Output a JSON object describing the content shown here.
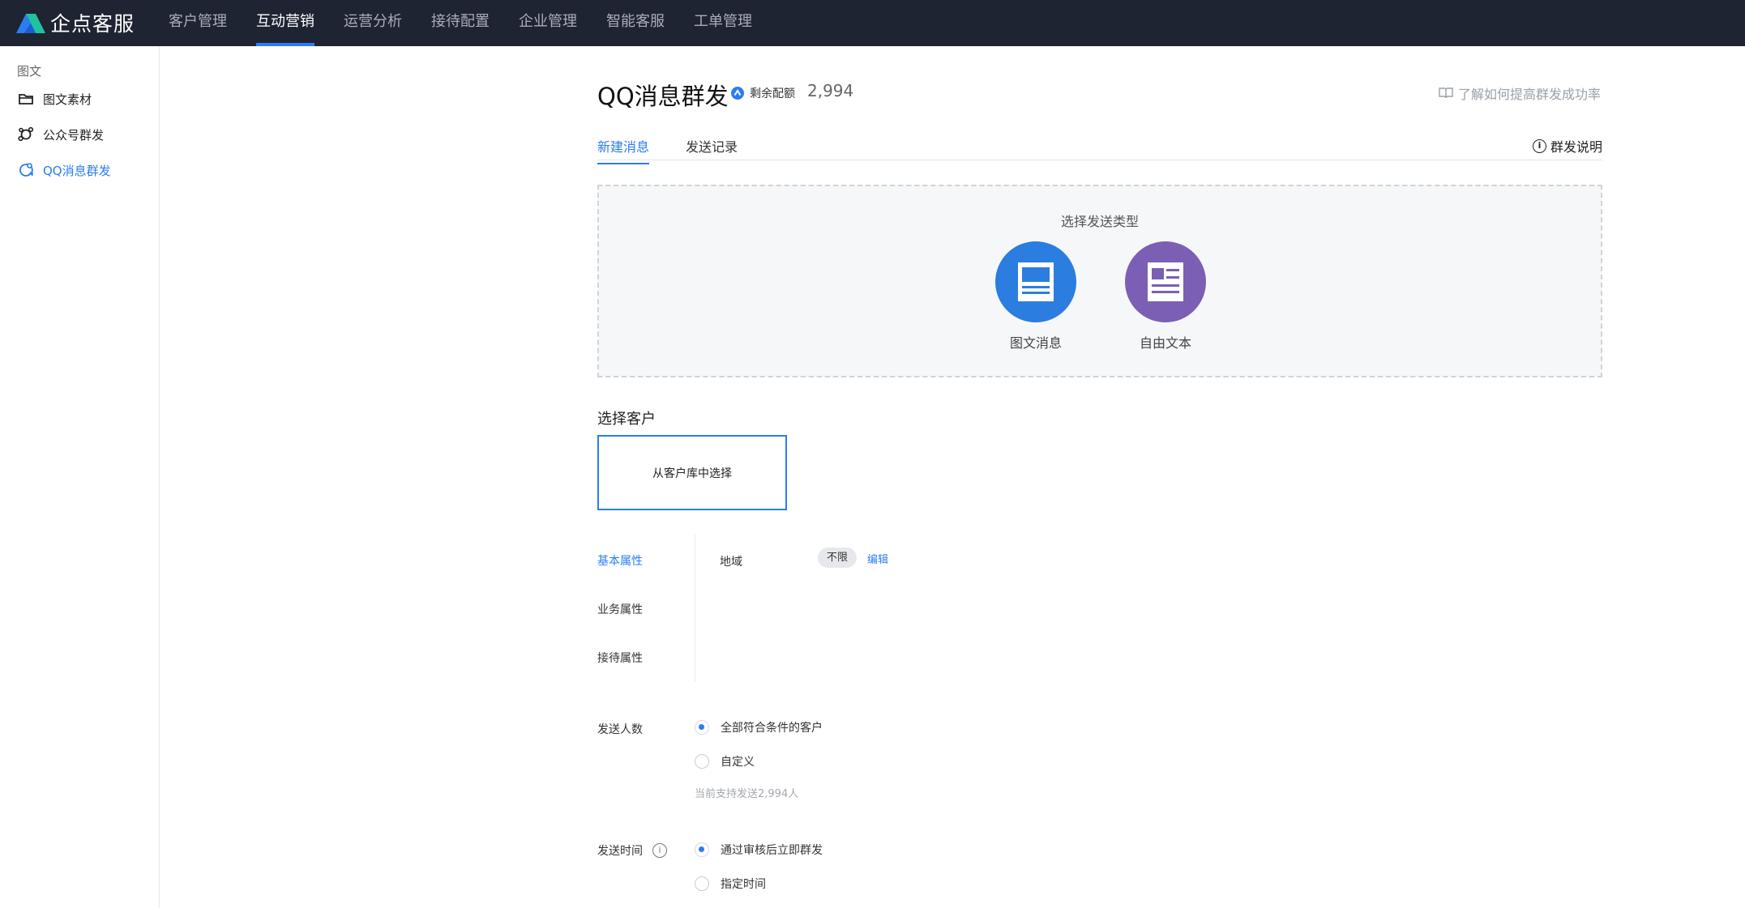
{
  "brand": {
    "name": "企点客服",
    "accent": "#2b7df0",
    "topbar_bg": "#1f2433"
  },
  "topnav": [
    {
      "label": "客户管理",
      "active": false
    },
    {
      "label": "互动营销",
      "active": true
    },
    {
      "label": "运营分析",
      "active": false
    },
    {
      "label": "接待配置",
      "active": false
    },
    {
      "label": "企业管理",
      "active": false
    },
    {
      "label": "智能客服",
      "active": false
    },
    {
      "label": "工单管理",
      "active": false
    }
  ],
  "sidebar": {
    "group_label": "图文",
    "items": [
      {
        "label": "图文素材",
        "icon": "folder-icon",
        "active": false
      },
      {
        "label": "公众号群发",
        "icon": "broadcast-icon",
        "active": false
      },
      {
        "label": "QQ消息群发",
        "icon": "qq-chat-icon",
        "active": true
      }
    ]
  },
  "header": {
    "title": "QQ消息群发",
    "quota_label": "剩余配额",
    "quota_value": "2,994",
    "help_link": "了解如何提高群发成功率"
  },
  "tabs": {
    "items": [
      {
        "label": "新建消息",
        "active": true
      },
      {
        "label": "发送记录",
        "active": false
      }
    ],
    "help": "群发说明"
  },
  "send_type": {
    "title": "选择发送类型",
    "options": [
      {
        "label": "图文消息",
        "icon": "article-icon",
        "color": "#2b7de0"
      },
      {
        "label": "自由文本",
        "icon": "text-doc-icon",
        "color": "#7b5fb4"
      }
    ]
  },
  "customer": {
    "title": "选择客户",
    "select_button": "从客户库中选择",
    "attribute_tabs": [
      {
        "label": "基本属性",
        "active": true
      },
      {
        "label": "业务属性",
        "active": false
      },
      {
        "label": "接待属性",
        "active": false
      }
    ],
    "region_label": "地域",
    "region_value": "不限",
    "edit_label": "编辑"
  },
  "send_count": {
    "label": "发送人数",
    "options": [
      {
        "label": "全部符合条件的客户",
        "selected": true
      },
      {
        "label": "自定义",
        "selected": false
      }
    ],
    "hint": "当前支持发送2,994人"
  },
  "send_time": {
    "label": "发送时间",
    "options": [
      {
        "label": "通过审核后立即群发",
        "selected": true
      },
      {
        "label": "指定时间",
        "selected": false
      }
    ]
  }
}
